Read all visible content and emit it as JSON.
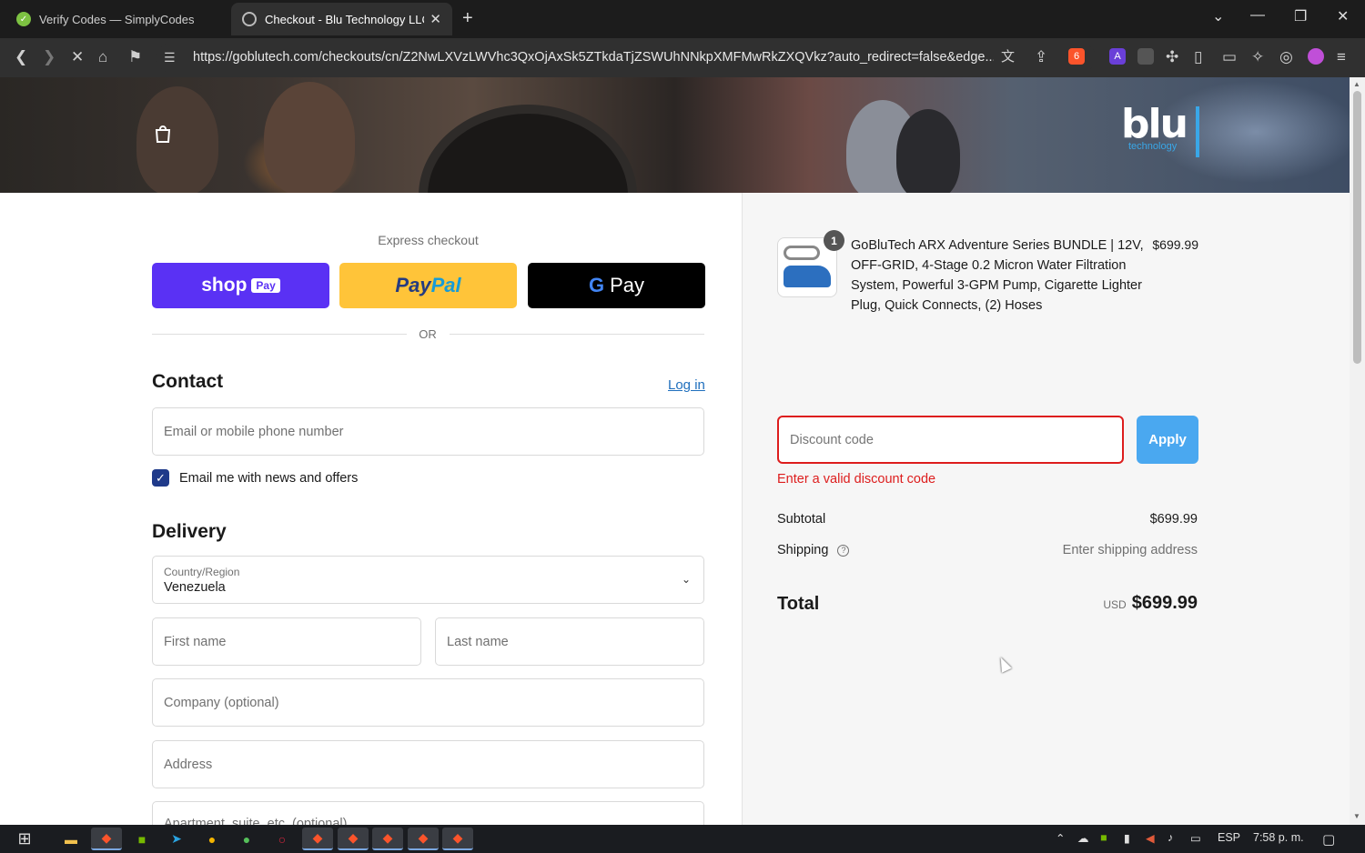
{
  "browser": {
    "tabs": [
      {
        "title": "Verify Codes — SimplyCodes"
      },
      {
        "title": "Checkout - Blu Technology LLC"
      }
    ],
    "url": "https://goblutech.com/checkouts/cn/Z2NwLXVzLWVhc3QxOjAxSk5ZTkdaTjZSWUhNNkpXMFMwRkZXQVkz?auto_redirect=false&edge...",
    "shield_count": "6"
  },
  "header": {
    "logo_text": "blu",
    "logo_sub": "technology"
  },
  "checkout": {
    "express_title": "Express checkout",
    "shop_pay": {
      "label": "shop",
      "chip": "Pay"
    },
    "paypal": {
      "part1": "Pay",
      "part2": "Pal"
    },
    "gpay": {
      "g": "G",
      "label": "Pay"
    },
    "or_text": "OR",
    "contact": {
      "title": "Contact",
      "login_link": "Log in",
      "email_placeholder": "Email or mobile phone number",
      "newsletter_label": "Email me with news and offers",
      "newsletter_checked": true
    },
    "delivery": {
      "title": "Delivery",
      "country_label": "Country/Region",
      "country_value": "Venezuela",
      "first_name_placeholder": "First name",
      "last_name_placeholder": "Last name",
      "company_placeholder": "Company (optional)",
      "address_placeholder": "Address",
      "apartment_placeholder": "Apartment, suite, etc. (optional)"
    }
  },
  "summary": {
    "item": {
      "quantity": "1",
      "title": "GoBluTech ARX Adventure Series BUNDLE | 12V, OFF-GRID, 4-Stage 0.2 Micron Water Filtration System, Powerful 3-GPM Pump, Cigarette Lighter Plug, Quick Connects, (2) Hoses",
      "price": "$699.99"
    },
    "discount": {
      "placeholder": "Discount code",
      "apply_label": "Apply",
      "error": "Enter a valid discount code"
    },
    "subtotal": {
      "label": "Subtotal",
      "value": "$699.99"
    },
    "shipping": {
      "label": "Shipping",
      "value": "Enter shipping address"
    },
    "total": {
      "label": "Total",
      "currency": "USD",
      "value": "$699.99"
    }
  },
  "taskbar": {
    "lang": "ESP",
    "time": "7:58 p. m."
  },
  "colors": {
    "shop_pay": "#5a31f4",
    "paypal": "#ffc439",
    "gpay": "#000000",
    "error": "#dd1d1d",
    "apply": "#4aa8f0",
    "link": "#1f6fbd"
  }
}
